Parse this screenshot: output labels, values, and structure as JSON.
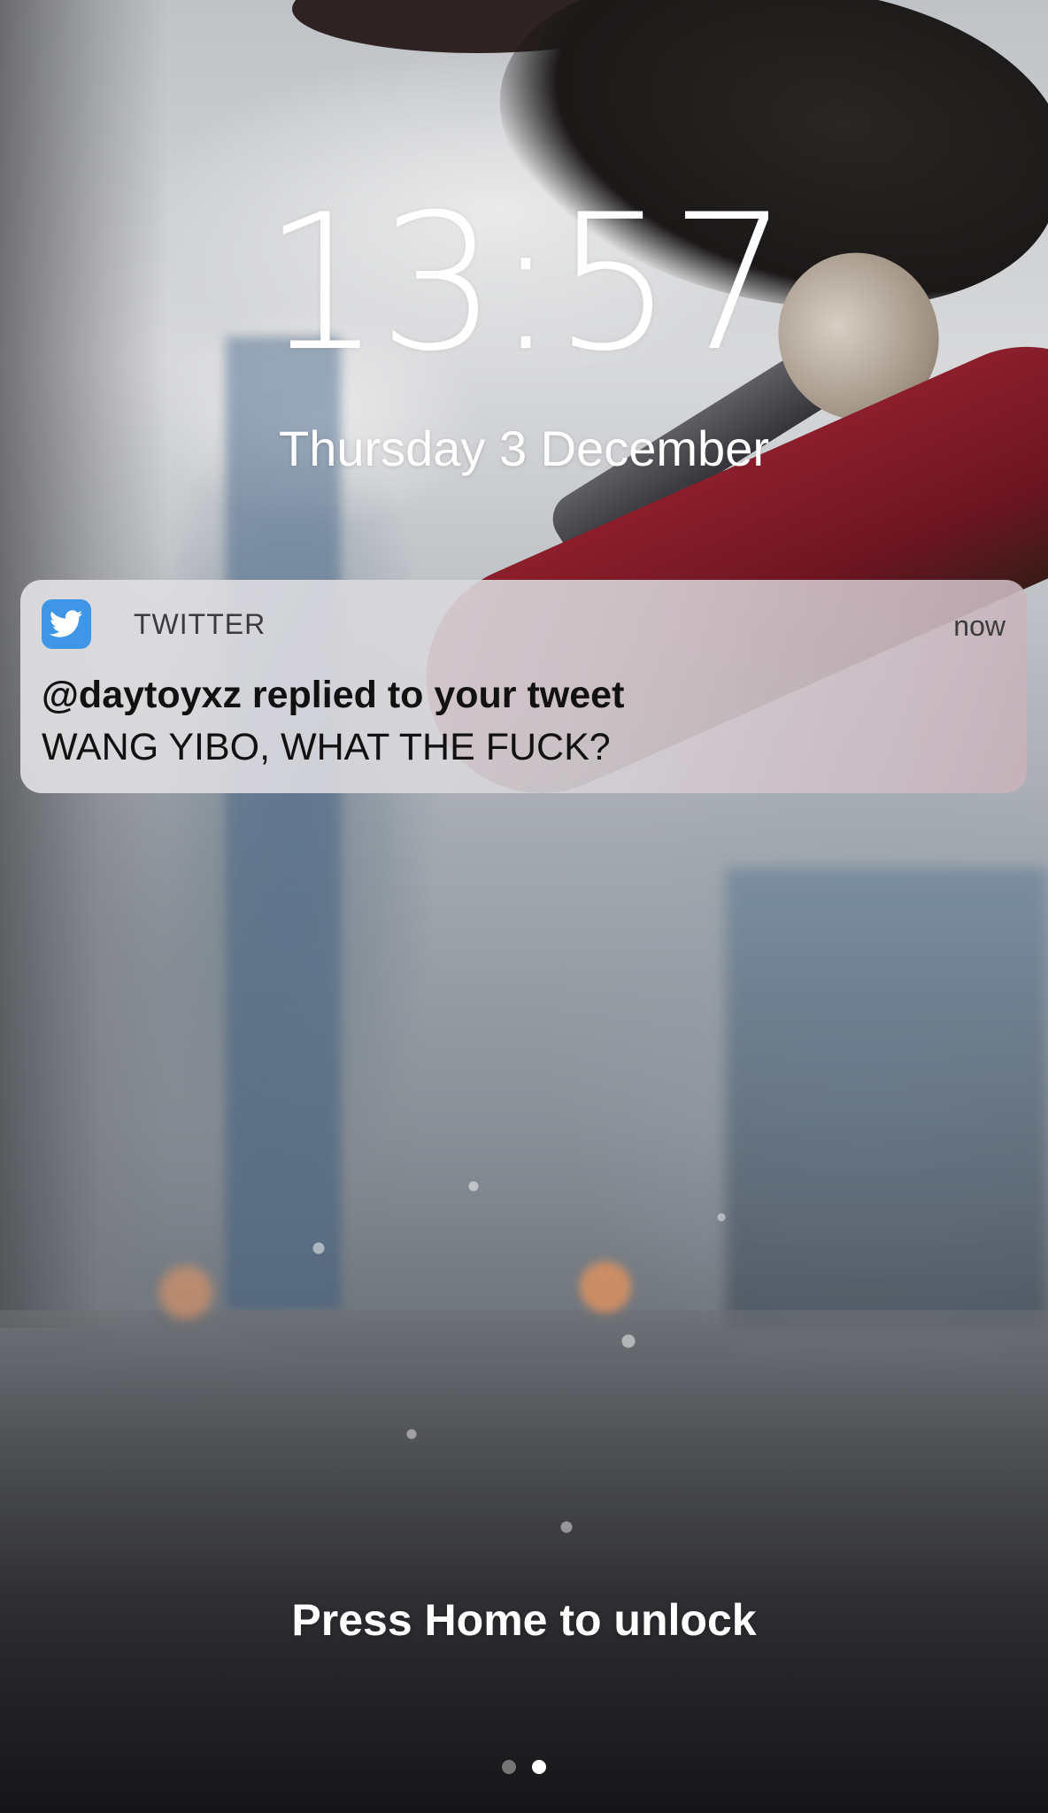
{
  "lock_screen": {
    "time": "13:57",
    "date": "Thursday 3 December",
    "unlock_hint": "Press Home to unlock",
    "page_indicator": {
      "pages": 2,
      "active_index": 1
    }
  },
  "notification": {
    "app_name": "TWITTER",
    "app_icon": "twitter-bird-icon",
    "app_icon_color": "#3f95e6",
    "time": "now",
    "title": "@daytoyxz replied to your tweet",
    "body": "WANG YIBO, WHAT THE FUCK?"
  }
}
